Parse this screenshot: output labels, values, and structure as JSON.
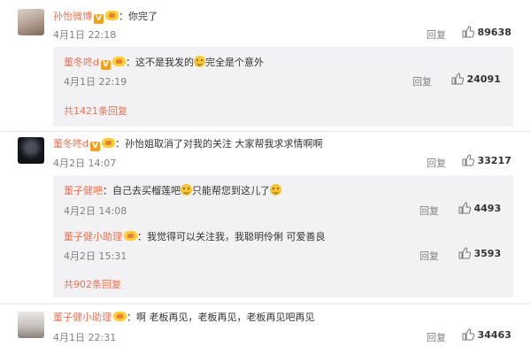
{
  "comments": [
    {
      "user": "孙怡微博",
      "sep": "：",
      "text": "你完了",
      "time": "4月1日 22:18",
      "reply_label": "回复",
      "likes": "89638",
      "subreplies": [
        {
          "user": "董冬咚d",
          "sep": "：",
          "text_before": "这不是我发的",
          "text_after": "完全是个意外",
          "time": "4月1日 22:19",
          "reply_label": "回复",
          "likes": "24091"
        }
      ],
      "more_link": "共1421条回复"
    },
    {
      "user": "董冬咚d",
      "sep": "：",
      "text": "孙怡姐取消了对我的关注 大家帮我求求情啊啊",
      "time": "4月2日 14:07",
      "reply_label": "回复",
      "likes": "33217",
      "subreplies": [
        {
          "user": "董子健吧",
          "sep": "：",
          "text_before": "自己去买榴莲吧",
          "text_after": "只能帮您到这儿了",
          "time": "4月2日 14:08",
          "reply_label": "回复",
          "likes": "4493"
        },
        {
          "user": "董子健小助理",
          "sep": "：",
          "text": "我觉得可以关注我，我聪明伶俐 可爱善良",
          "time": "4月2日 15:31",
          "reply_label": "回复",
          "likes": "3593"
        }
      ],
      "more_link": "共902条回复"
    },
    {
      "user": "董子健小助理",
      "sep": "：",
      "text": "啊 老板再见，老板再见，老板再见吧再见",
      "time": "4月1日 22:31",
      "reply_label": "回复",
      "likes": "34463"
    }
  ],
  "colors": {
    "username": "#eb7350",
    "meta": "#808080",
    "subreply_bg": "#f2f2f5",
    "badge": "#f0a21a"
  },
  "icons": {
    "verified": "v-badge-icon",
    "fan": "fan-badge-icon",
    "emoji": "smile-emoji-icon",
    "like": "thumbs-up-icon"
  }
}
